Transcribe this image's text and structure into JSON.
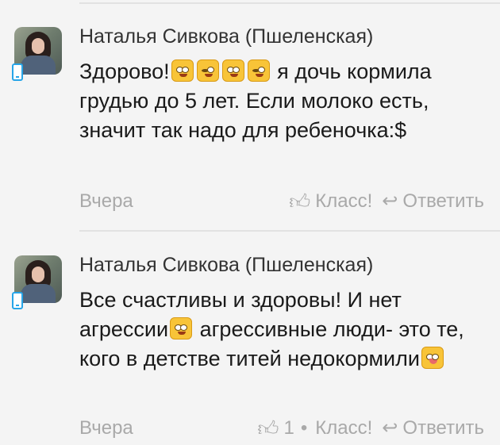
{
  "comments": [
    {
      "author": "Наталья Сивкова (Пшеленская)",
      "text_a": "Здорово!",
      "text_b": " я дочь кормила грудью до 5 лет. Если молоко есть, значит так надо для ребеночка:$",
      "date": "Вчера",
      "like_label": "Класс!",
      "reply_label": "Ответить"
    },
    {
      "author": "Наталья Сивкова (Пшеленская)",
      "text_a": "Все счастливы и здоровы! И нет агрессии",
      "text_b": " агрессивные люди- это те, кого в детстве титей недокормили",
      "date": "Вчера",
      "like_count": "1",
      "like_label": "Класс!",
      "reply_label": "Ответить"
    }
  ],
  "icons": {
    "like": "thumb-up-icon",
    "reply": "reply-arrow-icon",
    "device": "mobile-phone-icon",
    "accent": "#27a5e8"
  }
}
